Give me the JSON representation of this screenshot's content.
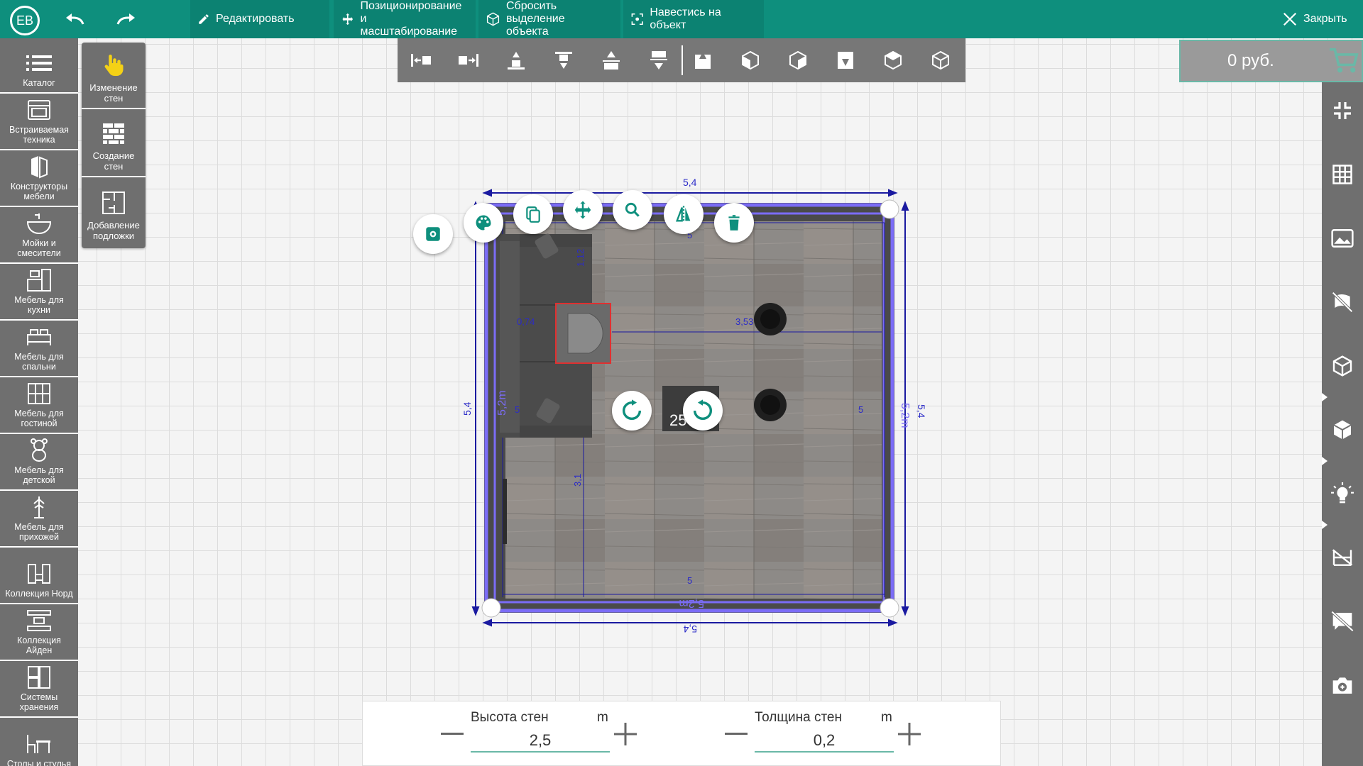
{
  "header": {
    "user_initials": "ЕВ",
    "edit_label": "Редактировать",
    "positioning_label_1": "Позиционирование и",
    "positioning_label_2": "масштабирование",
    "reset_label_1": "Сбросить выделение",
    "reset_label_2": "объекта",
    "focus_label": "Навестись на объект",
    "close_label": "Закрыть"
  },
  "price": {
    "amount": "0 руб."
  },
  "sidebar": {
    "items": [
      {
        "label_1": "Каталог",
        "label_2": ""
      },
      {
        "label_1": "Встраиваемая",
        "label_2": "техника"
      },
      {
        "label_1": "Конструкторы",
        "label_2": "мебели"
      },
      {
        "label_1": "Мойки и",
        "label_2": "смесители"
      },
      {
        "label_1": "Мебель для",
        "label_2": "кухни"
      },
      {
        "label_1": "Мебель для",
        "label_2": "спальни"
      },
      {
        "label_1": "Мебель для",
        "label_2": "гостиной"
      },
      {
        "label_1": "Мебель для",
        "label_2": "детской"
      },
      {
        "label_1": "Мебель для",
        "label_2": "прихожей"
      },
      {
        "label_1": "Коллекция Норд",
        "label_2": ""
      },
      {
        "label_1": "Коллекция",
        "label_2": "Айден"
      },
      {
        "label_1": "Системы",
        "label_2": "хранения"
      },
      {
        "label_1": "Столы и стулья",
        "label_2": ""
      }
    ]
  },
  "wall_tools": {
    "change_1": "Изменение",
    "change_2": "стен",
    "create_1": "Создание",
    "create_2": "стен",
    "underlay_1": "Добавление",
    "underlay_2": "подложки"
  },
  "room": {
    "dim_top": "5,4",
    "dim_bottom": "5,4",
    "dim_left": "5,4",
    "dim_right": "5,4",
    "inner_left": "5,2m",
    "inner_right": "5,2m",
    "inner_bottom": "5,2m",
    "inner_top_small": "5",
    "inner_bottom_small": "5",
    "inner_left_small": "5",
    "inner_right_small": "5",
    "sofa_depth": "1,12",
    "chair_offset": "0,74",
    "chair_to_wall": "3,53",
    "sofa_to_bottom": "3,1",
    "table_label": "25"
  },
  "wall_params": {
    "height_label": "Высота стен",
    "height_unit": "m",
    "height_value": "2,5",
    "thickness_label": "Толщина стен",
    "thickness_unit": "m",
    "thickness_value": "0,2"
  },
  "colors": {
    "brand": "#0e8f7d",
    "panel": "#6f6f6f",
    "wall_highlight": "#7b6cf6",
    "dimension": "#1a1aa0",
    "accent": "#6ab8a7"
  }
}
